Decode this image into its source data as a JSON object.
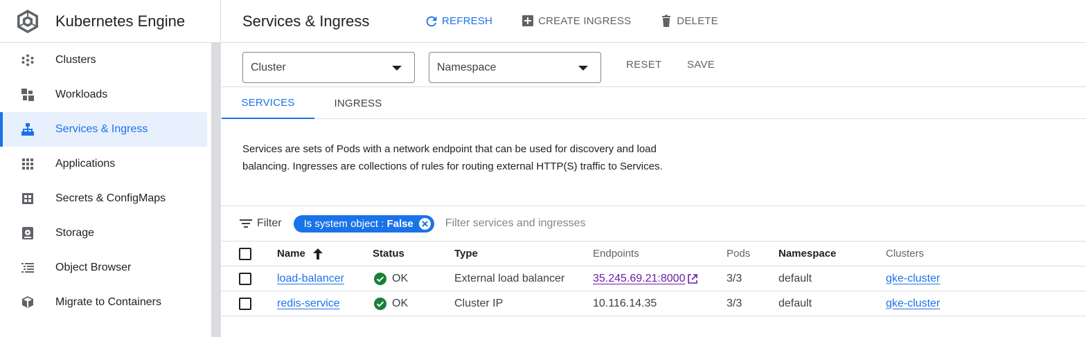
{
  "brand": {
    "title": "Kubernetes Engine"
  },
  "sidebar": {
    "items": [
      {
        "label": "Clusters",
        "icon": "clusters-icon",
        "active": false
      },
      {
        "label": "Workloads",
        "icon": "workloads-icon",
        "active": false
      },
      {
        "label": "Services & Ingress",
        "icon": "services-icon",
        "active": true
      },
      {
        "label": "Applications",
        "icon": "applications-icon",
        "active": false
      },
      {
        "label": "Secrets & ConfigMaps",
        "icon": "secrets-icon",
        "active": false
      },
      {
        "label": "Storage",
        "icon": "storage-icon",
        "active": false
      },
      {
        "label": "Object Browser",
        "icon": "object-browser-icon",
        "active": false
      },
      {
        "label": "Migrate to Containers",
        "icon": "migrate-icon",
        "active": false
      }
    ]
  },
  "header": {
    "title": "Services & Ingress",
    "refresh_label": "REFRESH",
    "create_label": "CREATE INGRESS",
    "delete_label": "DELETE"
  },
  "filters": {
    "cluster_label": "Cluster",
    "namespace_label": "Namespace",
    "reset_label": "RESET",
    "save_label": "SAVE"
  },
  "tabs": [
    {
      "label": "SERVICES",
      "active": true
    },
    {
      "label": "INGRESS",
      "active": false
    }
  ],
  "description": "Services are sets of Pods with a network endpoint that can be used for discovery and load balancing. Ingresses are collections of rules for routing external HTTP(S) traffic to Services.",
  "filterbar": {
    "label": "Filter",
    "chip_key": "Is system object :",
    "chip_value": "False",
    "placeholder": "Filter services and ingresses"
  },
  "table": {
    "columns": {
      "name": "Name",
      "status": "Status",
      "type": "Type",
      "endpoints": "Endpoints",
      "pods": "Pods",
      "namespace": "Namespace",
      "clusters": "Clusters"
    },
    "rows": [
      {
        "name": "load-balancer",
        "status": "OK",
        "type": "External load balancer",
        "endpoints": "35.245.69.21:8000",
        "pods": "3/3",
        "namespace": "default",
        "clusters": "gke-cluster"
      },
      {
        "name": "redis-service",
        "status": "OK",
        "type": "Cluster IP",
        "endpoints": "10.116.14.35",
        "pods": "3/3",
        "namespace": "default",
        "clusters": "gke-cluster"
      }
    ]
  },
  "colors": {
    "accent": "#1a73e8",
    "ok_green": "#188038",
    "visited_link": "#681da8"
  }
}
